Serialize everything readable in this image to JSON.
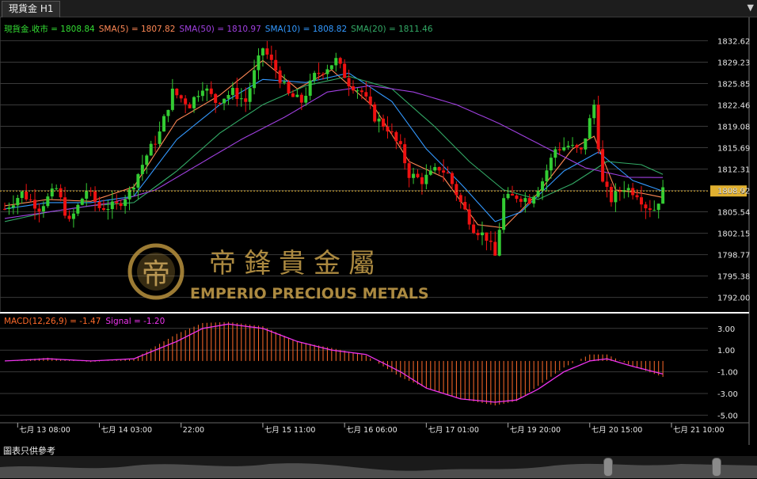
{
  "window": {
    "tab_label": "現貨金 H1",
    "menu_icon": "triangle-down-icon",
    "disclaimer": "圖表只供參考"
  },
  "watermark": {
    "brand_cn": "帝鋒貴金屬",
    "brand_en": "EMPERIO PRECIOUS METALS",
    "logo_text": "帝"
  },
  "chart_data": [
    {
      "type": "candlestick",
      "title": "現貨金 H1",
      "legend": [
        {
          "label": "現貨金.收市 = 1808.84",
          "color": "#33dd33"
        },
        {
          "label": "SMA(5) = 1807.82",
          "color": "#ff8855"
        },
        {
          "label": "SMA(50) = 1810.97",
          "color": "#a040e0"
        },
        {
          "label": "SMA(10) = 1808.82",
          "color": "#3399ff"
        },
        {
          "label": "SMA(20) = 1811.46",
          "color": "#33aa66"
        }
      ],
      "y_ticks": [
        "1832.62",
        "1829.23",
        "1825.85",
        "1822.46",
        "1819.08",
        "1815.69",
        "1812.31",
        "1808.92",
        "1805.54",
        "1802.15",
        "1798.77",
        "1795.38",
        "1792.00"
      ],
      "ylim": [
        1789.7,
        1834.8
      ],
      "current_price": "1808.84",
      "x_ticks": [
        "七月 13 08:00",
        "七月 14 03:00",
        "22:00",
        "七月 15 11:00",
        "七月 16 06:00",
        "七月 17 01:00",
        "七月 19 20:00",
        "七月 20 15:00",
        "七月 21 10:00"
      ],
      "x_tick_index": [
        3,
        22,
        41,
        60,
        79,
        98,
        117,
        136,
        155
      ],
      "colors": {
        "up": "#33cc33",
        "down": "#ee1111",
        "current": "#e0b030"
      },
      "close_path": [
        [
          0,
          1806.0
        ],
        [
          4,
          1808.5
        ],
        [
          8,
          1806.2
        ],
        [
          12,
          1809.2
        ],
        [
          15,
          1803.8
        ],
        [
          19,
          1809.0
        ],
        [
          22,
          1806.2
        ],
        [
          26,
          1806.5
        ],
        [
          29,
          1808.7
        ],
        [
          33,
          1814.5
        ],
        [
          36,
          1818.0
        ],
        [
          39,
          1824.5
        ],
        [
          43,
          1822.5
        ],
        [
          46,
          1825.5
        ],
        [
          49,
          1823.0
        ],
        [
          53,
          1824.5
        ],
        [
          56,
          1823.0
        ],
        [
          58,
          1827.5
        ],
        [
          60,
          1831.5
        ],
        [
          63,
          1828.0
        ],
        [
          66,
          1824.0
        ],
        [
          69,
          1823.0
        ],
        [
          72,
          1827.0
        ],
        [
          75,
          1828.5
        ],
        [
          77,
          1829.5
        ],
        [
          80,
          1826.0
        ],
        [
          83,
          1824.5
        ],
        [
          86,
          1820.5
        ],
        [
          89,
          1818.8
        ],
        [
          92,
          1815.5
        ],
        [
          94,
          1811.5
        ],
        [
          97,
          1810.5
        ],
        [
          101,
          1812.5
        ],
        [
          103,
          1811.5
        ],
        [
          106,
          1807.0
        ],
        [
          109,
          1803.0
        ],
        [
          112,
          1801.5
        ],
        [
          114,
          1798.5
        ],
        [
          116,
          1807.5
        ],
        [
          119,
          1808.0
        ],
        [
          122,
          1807.5
        ],
        [
          125,
          1810.5
        ],
        [
          128,
          1815.5
        ],
        [
          131,
          1816.0
        ],
        [
          134,
          1815.0
        ],
        [
          137,
          1822.5
        ],
        [
          139,
          1810.0
        ],
        [
          141,
          1807.5
        ],
        [
          144,
          1809.5
        ],
        [
          147,
          1808.5
        ],
        [
          149,
          1806.5
        ],
        [
          151,
          1806.0
        ],
        [
          153,
          1808.84
        ]
      ],
      "ma_paths": [
        {
          "name": "SMA(5)",
          "color": "#ff8855",
          "points": [
            [
              0,
              1806.5
            ],
            [
              10,
              1807.5
            ],
            [
              20,
              1807.2
            ],
            [
              30,
              1809.5
            ],
            [
              40,
              1820.0
            ],
            [
              50,
              1824.0
            ],
            [
              60,
              1829.5
            ],
            [
              68,
              1825.0
            ],
            [
              76,
              1828.0
            ],
            [
              86,
              1822.0
            ],
            [
              94,
              1813.5
            ],
            [
              102,
              1811.0
            ],
            [
              110,
              1803.5
            ],
            [
              116,
              1803.0
            ],
            [
              124,
              1808.5
            ],
            [
              132,
              1815.5
            ],
            [
              137,
              1817.5
            ],
            [
              142,
              1809.0
            ],
            [
              148,
              1808.5
            ],
            [
              153,
              1807.82
            ]
          ]
        },
        {
          "name": "SMA(10)",
          "color": "#3399ff",
          "points": [
            [
              0,
              1806.0
            ],
            [
              10,
              1807.0
            ],
            [
              20,
              1807.0
            ],
            [
              30,
              1808.0
            ],
            [
              40,
              1817.0
            ],
            [
              50,
              1822.5
            ],
            [
              60,
              1826.5
            ],
            [
              70,
              1826.0
            ],
            [
              80,
              1827.5
            ],
            [
              90,
              1823.0
            ],
            [
              98,
              1815.5
            ],
            [
              106,
              1810.0
            ],
            [
              114,
              1804.0
            ],
            [
              120,
              1805.5
            ],
            [
              130,
              1812.0
            ],
            [
              138,
              1815.0
            ],
            [
              146,
              1810.5
            ],
            [
              153,
              1808.82
            ]
          ]
        },
        {
          "name": "SMA(20)",
          "color": "#33aa66",
          "points": [
            [
              0,
              1804.0
            ],
            [
              10,
              1805.5
            ],
            [
              20,
              1806.5
            ],
            [
              30,
              1807.0
            ],
            [
              40,
              1812.0
            ],
            [
              50,
              1818.0
            ],
            [
              60,
              1822.5
            ],
            [
              70,
              1825.5
            ],
            [
              80,
              1827.0
            ],
            [
              90,
              1825.0
            ],
            [
              100,
              1819.0
            ],
            [
              108,
              1813.5
            ],
            [
              116,
              1809.0
            ],
            [
              124,
              1807.5
            ],
            [
              132,
              1810.0
            ],
            [
              140,
              1813.5
            ],
            [
              148,
              1813.0
            ],
            [
              153,
              1811.46
            ]
          ]
        },
        {
          "name": "SMA(50)",
          "color": "#a040e0",
          "points": [
            [
              0,
              1804.5
            ],
            [
              15,
              1806.0
            ],
            [
              25,
              1807.0
            ],
            [
              35,
              1809.0
            ],
            [
              45,
              1813.0
            ],
            [
              55,
              1817.0
            ],
            [
              65,
              1820.5
            ],
            [
              75,
              1824.5
            ],
            [
              85,
              1825.5
            ],
            [
              95,
              1824.5
            ],
            [
              105,
              1822.5
            ],
            [
              115,
              1819.5
            ],
            [
              125,
              1816.0
            ],
            [
              135,
              1812.5
            ],
            [
              145,
              1811.0
            ],
            [
              153,
              1810.97
            ]
          ]
        }
      ]
    },
    {
      "type": "bar",
      "title": "MACD(12,26,9) = -1.47",
      "legend": [
        {
          "label": "MACD(12,26,9) = -1.47",
          "color": "#ff6a2a"
        },
        {
          "label": "Signal = -1.20",
          "color": "#ee33ee"
        }
      ],
      "y_ticks": [
        "3.00",
        "1.00",
        "-1.00",
        "-3.00",
        "-5.00"
      ],
      "ylim": [
        -5.7,
        4.3
      ],
      "macd_path": [
        [
          0,
          0.0
        ],
        [
          10,
          0.3
        ],
        [
          20,
          -0.1
        ],
        [
          30,
          0.2
        ],
        [
          40,
          2.5
        ],
        [
          46,
          3.5
        ],
        [
          52,
          3.6
        ],
        [
          60,
          3.2
        ],
        [
          68,
          1.8
        ],
        [
          76,
          1.2
        ],
        [
          84,
          0.5
        ],
        [
          92,
          -1.5
        ],
        [
          98,
          -2.5
        ],
        [
          106,
          -3.5
        ],
        [
          114,
          -4.1
        ],
        [
          119,
          -3.7
        ],
        [
          124,
          -2.3
        ],
        [
          130,
          -0.6
        ],
        [
          136,
          0.6
        ],
        [
          140,
          0.6
        ],
        [
          146,
          -0.5
        ],
        [
          153,
          -1.47
        ]
      ],
      "signal_path": [
        [
          0,
          0.0
        ],
        [
          10,
          0.2
        ],
        [
          20,
          0.0
        ],
        [
          30,
          0.2
        ],
        [
          40,
          1.8
        ],
        [
          46,
          3.0
        ],
        [
          52,
          3.4
        ],
        [
          60,
          3.0
        ],
        [
          68,
          1.8
        ],
        [
          76,
          1.0
        ],
        [
          84,
          0.6
        ],
        [
          92,
          -1.0
        ],
        [
          98,
          -2.5
        ],
        [
          106,
          -3.5
        ],
        [
          114,
          -3.8
        ],
        [
          119,
          -3.6
        ],
        [
          124,
          -2.6
        ],
        [
          130,
          -1.0
        ],
        [
          136,
          0.0
        ],
        [
          140,
          0.2
        ],
        [
          146,
          -0.5
        ],
        [
          153,
          -1.2
        ]
      ]
    }
  ]
}
